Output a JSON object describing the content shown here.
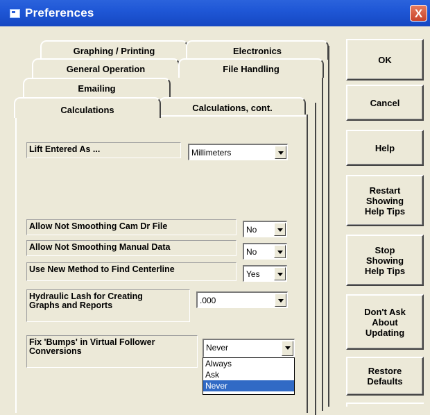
{
  "window": {
    "title": "Preferences",
    "close_glyph": "X"
  },
  "tabs": {
    "row1": [
      "Graphing / Printing",
      "Electronics"
    ],
    "row2": [
      "General Operation",
      "File Handling"
    ],
    "row3": [
      "Emailing"
    ],
    "row4": [
      "Calculations",
      "Calculations, cont."
    ]
  },
  "buttons": {
    "ok": "OK",
    "cancel": "Cancel",
    "help": "Help",
    "restart": "Restart\nShowing\nHelp Tips",
    "stop": "Stop\nShowing\nHelp Tips",
    "dont_ask": "Don't Ask\nAbout\nUpdating",
    "restore": "Restore\nDefaults"
  },
  "settings": {
    "lift": {
      "label": "Lift Entered As ...",
      "value": "Millimeters"
    },
    "cam_dr": {
      "label": "Allow Not Smoothing Cam Dr File",
      "value": "No"
    },
    "manual": {
      "label": "Allow Not Smoothing Manual Data",
      "value": "No"
    },
    "centerline": {
      "label": "Use New Method to Find Centerline",
      "value": "Yes"
    },
    "lash": {
      "label": "Hydraulic Lash for Creating\nGraphs and Reports",
      "value": ".000"
    },
    "bumps": {
      "label": "Fix 'Bumps' in Virtual Follower\nConversions",
      "value": "Never",
      "options": [
        "Always",
        "Ask",
        "Never"
      ]
    }
  }
}
